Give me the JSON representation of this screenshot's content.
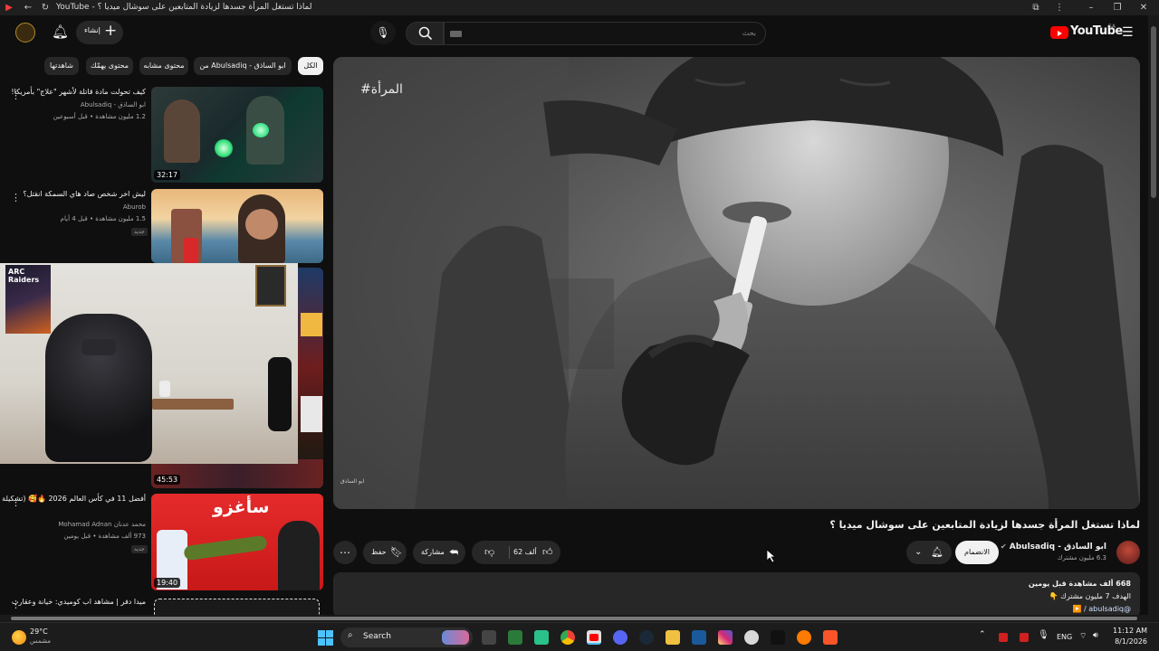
{
  "browser": {
    "tab_title": "YouTube - لماذا تستغل المرأة جسدها لزيادة المتابعين على سوشال ميديا ؟"
  },
  "masthead": {
    "create_label": "إنشاء",
    "search_placeholder": "بحث",
    "logo_text": "YouTube",
    "region": "SA"
  },
  "chips": [
    {
      "label": "الكل",
      "active": true
    },
    {
      "label": "من Abulsadiq - ابو الساذق"
    },
    {
      "label": "محتوى مشابه"
    },
    {
      "label": "محتوى يهمّك"
    },
    {
      "label": "شاهدتها"
    }
  ],
  "sidebar_videos": [
    {
      "title": "كيف تحولت مادة قاتلة لأشهر \"علاج\" بأمريكا!",
      "channel": "ابو الساذق - Abulsadiq",
      "meta": "1.2 مليون مشاهدة • قبل أسبوعين",
      "duration": "32:17"
    },
    {
      "title": "ليش اخر شخص صاد هاي السمكة انقتل؟",
      "channel": "Aburob",
      "meta": "1.5 مليون مشاهدة • قبل 4 أيام",
      "badge": "جديد"
    },
    {
      "title": "",
      "channel": "",
      "meta": "",
      "duration": "45:53"
    },
    {
      "title": "أفضل 11 في كأس العالم 2026 🔥🥰 (تشكيلة مرعبة)",
      "channel": "محمد عدنان Mohamad Adnan",
      "meta": "973 ألف مشاهدة • قبل يومين",
      "badge": "جديد",
      "duration": "19:40",
      "thumb_text": "سأغزو"
    },
    {
      "title": "ميدا دفر | مشاهد اب كوميدي: خيانة وعقارب",
      "channel": "",
      "meta": ""
    }
  ],
  "pip": {
    "poster_text": "ARC Raiders"
  },
  "player": {
    "hashtag": "#المرأة",
    "watermark": "ابو الساذق"
  },
  "video": {
    "title": "لماذا تستغل المرأة جسدها لزيادة المتابعين على سوشال ميديا ؟",
    "channel": "Abulsadiq - ابو الساذق",
    "subscribers": "6.3 مليون مشترك",
    "join_label": "الانضمام",
    "likes": "62 ألف",
    "share_label": "مشاركة",
    "save_label": "حفظ"
  },
  "description": {
    "line1": "668 ألف مشاهدة  قبل يومين",
    "line2": "الهدف 7 مليون مشترك 👇",
    "line3": "@abulsadiq / ▶️"
  },
  "taskbar": {
    "temp": "29°C",
    "weather": "مشمس",
    "search_label": "Search",
    "lang": "ENG",
    "time": "11:12 AM",
    "date": "8/1/2026"
  },
  "colors": {
    "accent_red": "#ff0000",
    "bg": "#0f0f0f"
  }
}
